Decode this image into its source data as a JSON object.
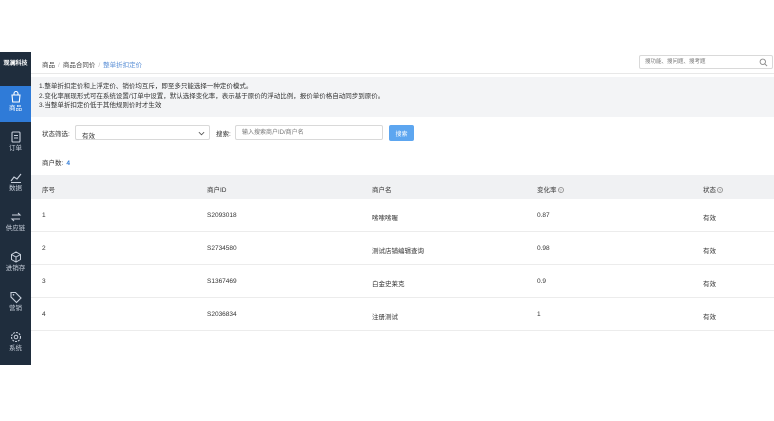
{
  "brand": "观澜科技",
  "nav": [
    {
      "label": "商品",
      "icon": "bag-icon",
      "active": true
    },
    {
      "label": "订单",
      "icon": "order-icon",
      "active": false
    },
    {
      "label": "数据",
      "icon": "chart-icon",
      "active": false
    },
    {
      "label": "供应链",
      "icon": "swap-icon",
      "active": false
    },
    {
      "label": "进销存",
      "icon": "box-icon",
      "active": false
    },
    {
      "label": "营销",
      "icon": "tag-icon",
      "active": false
    },
    {
      "label": "系统",
      "icon": "gear-icon",
      "active": false
    }
  ],
  "breadcrumb": [
    "商品",
    "商品合同价",
    "整单折扣定价"
  ],
  "global_search": {
    "placeholder": "搜功能、搜问题、搜考题"
  },
  "notice": [
    "1.整单折扣定价和上浮定价、销价均互斥，即至多只能选择一种定价模式。",
    "2.变化率展现形式可在系统设置/订单中设置，默认选择变化率，表示基于原价的浮动比例，报价单价格自动同步到原价。",
    "3.当整单折扣定价低于其他规则价时才生效"
  ],
  "filter": {
    "status_label": "状态筛选:",
    "status_value": "有效",
    "search_label": "搜索:",
    "search_placeholder": "输入搜索商户ID/商户名",
    "search_button": "搜索"
  },
  "count": {
    "label": "商户数:",
    "value": "4"
  },
  "table": {
    "headers": [
      "序号",
      "商户ID",
      "商户名",
      "变化率",
      "状态"
    ],
    "rows": [
      [
        "1",
        "S2093018",
        "嗦嗦嗦喔",
        "0.87",
        "有效"
      ],
      [
        "2",
        "S2734580",
        "测试店铺编辑查询",
        "0.98",
        "有效"
      ],
      [
        "3",
        "S1367469",
        "白金史莱克",
        "0.9",
        "有效"
      ],
      [
        "4",
        "S2036834",
        "注册测试",
        "1",
        "有效"
      ]
    ]
  },
  "colors": {
    "sidebar": "#1f2d3d",
    "accent": "#2f7bd8",
    "button": "#5da6f0"
  }
}
